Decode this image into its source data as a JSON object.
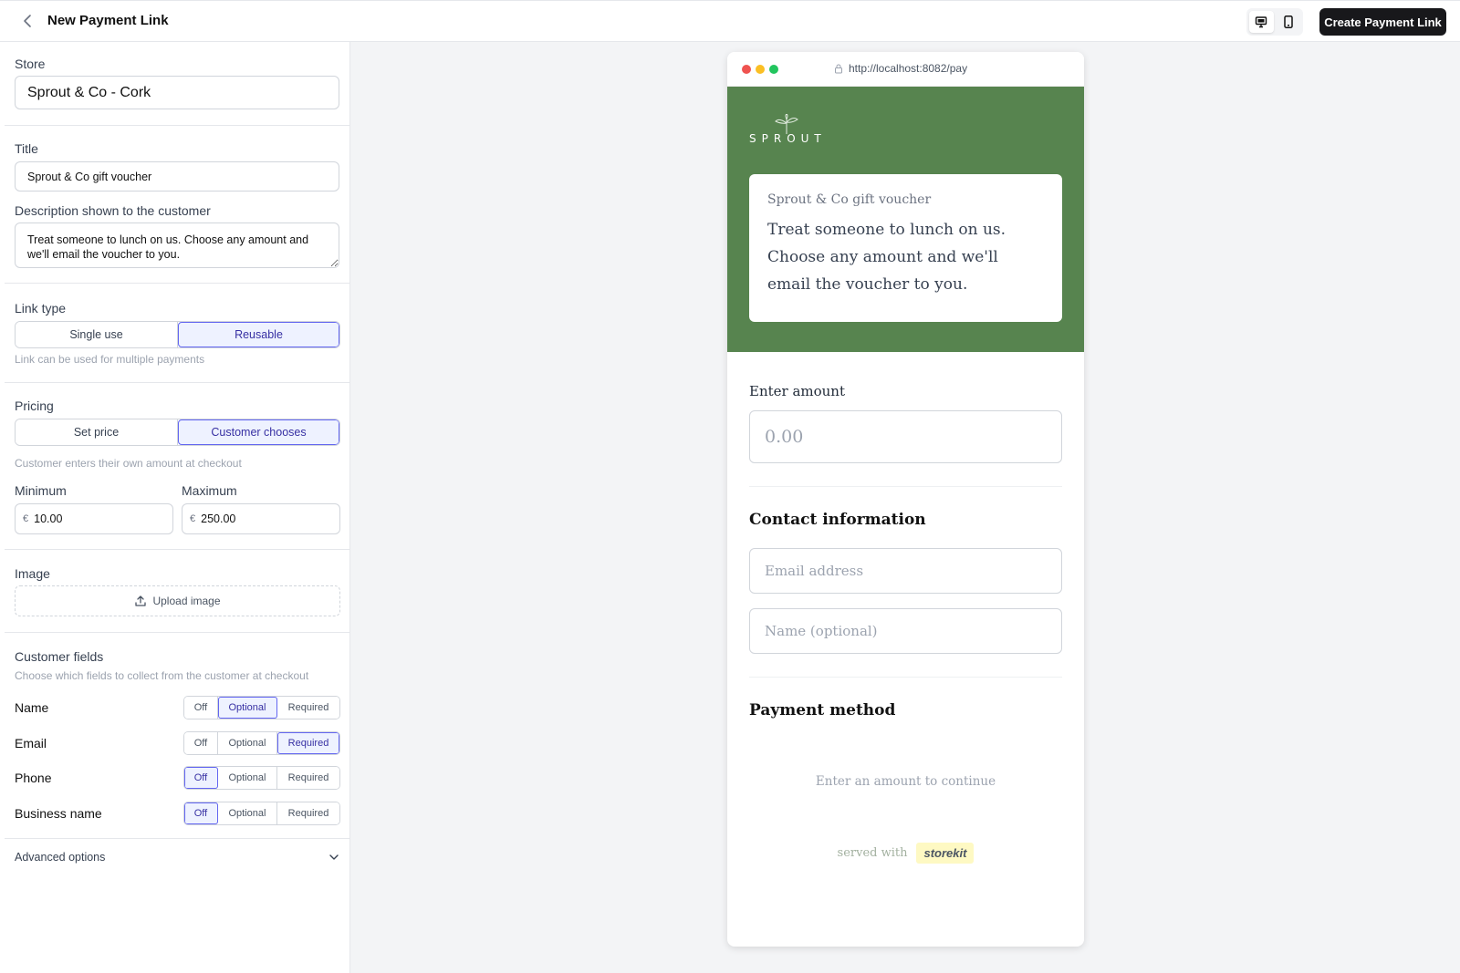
{
  "header": {
    "title": "New Payment Link",
    "create_label": "Create Payment Link"
  },
  "form": {
    "store_label": "Store",
    "store_value": "Sprout & Co - Cork",
    "title_label": "Title",
    "title_value": "Sprout & Co gift voucher",
    "description_label": "Description shown to the customer",
    "description_value": "Treat someone to lunch on us. Choose any amount and we'll email the voucher to you.",
    "link_type": {
      "label": "Link type",
      "options": [
        "Single use",
        "Reusable"
      ],
      "selected": "Reusable",
      "help": "Link can be used for multiple payments"
    },
    "pricing": {
      "label": "Pricing",
      "options": [
        "Set price",
        "Customer chooses"
      ],
      "selected": "Customer chooses",
      "help": "Customer enters their own amount at checkout"
    },
    "minimum": {
      "label": "Minimum",
      "currency": "€",
      "value": "10.00"
    },
    "maximum": {
      "label": "Maximum",
      "currency": "€",
      "value": "250.00"
    },
    "image": {
      "label": "Image",
      "upload_label": "Upload image"
    },
    "customer_fields": {
      "label": "Customer fields",
      "help": "Choose which fields to collect from the customer at checkout",
      "options": [
        "Off",
        "Optional",
        "Required"
      ],
      "rows": [
        {
          "name": "Name",
          "selected": "Optional"
        },
        {
          "name": "Email",
          "selected": "Required"
        },
        {
          "name": "Phone",
          "selected": "Off"
        },
        {
          "name": "Business name",
          "selected": "Off"
        }
      ]
    },
    "advanced_label": "Advanced options"
  },
  "preview": {
    "url": "http://localhost:8082/pay",
    "brand": "SPROUT",
    "card_title": "Sprout & Co gift voucher",
    "card_description": "Treat someone to lunch on us. Choose any amount and we'll email the voucher to you.",
    "amount_label": "Enter amount",
    "amount_placeholder": "0.00",
    "contact_heading": "Contact information",
    "email_placeholder": "Email address",
    "name_placeholder": "Name (optional)",
    "payment_heading": "Payment method",
    "payment_note": "Enter an amount to continue",
    "served_with": "served with",
    "powered_brand": "storekit",
    "colors": {
      "hero": "#57844f",
      "accent": "#6366f1"
    }
  }
}
